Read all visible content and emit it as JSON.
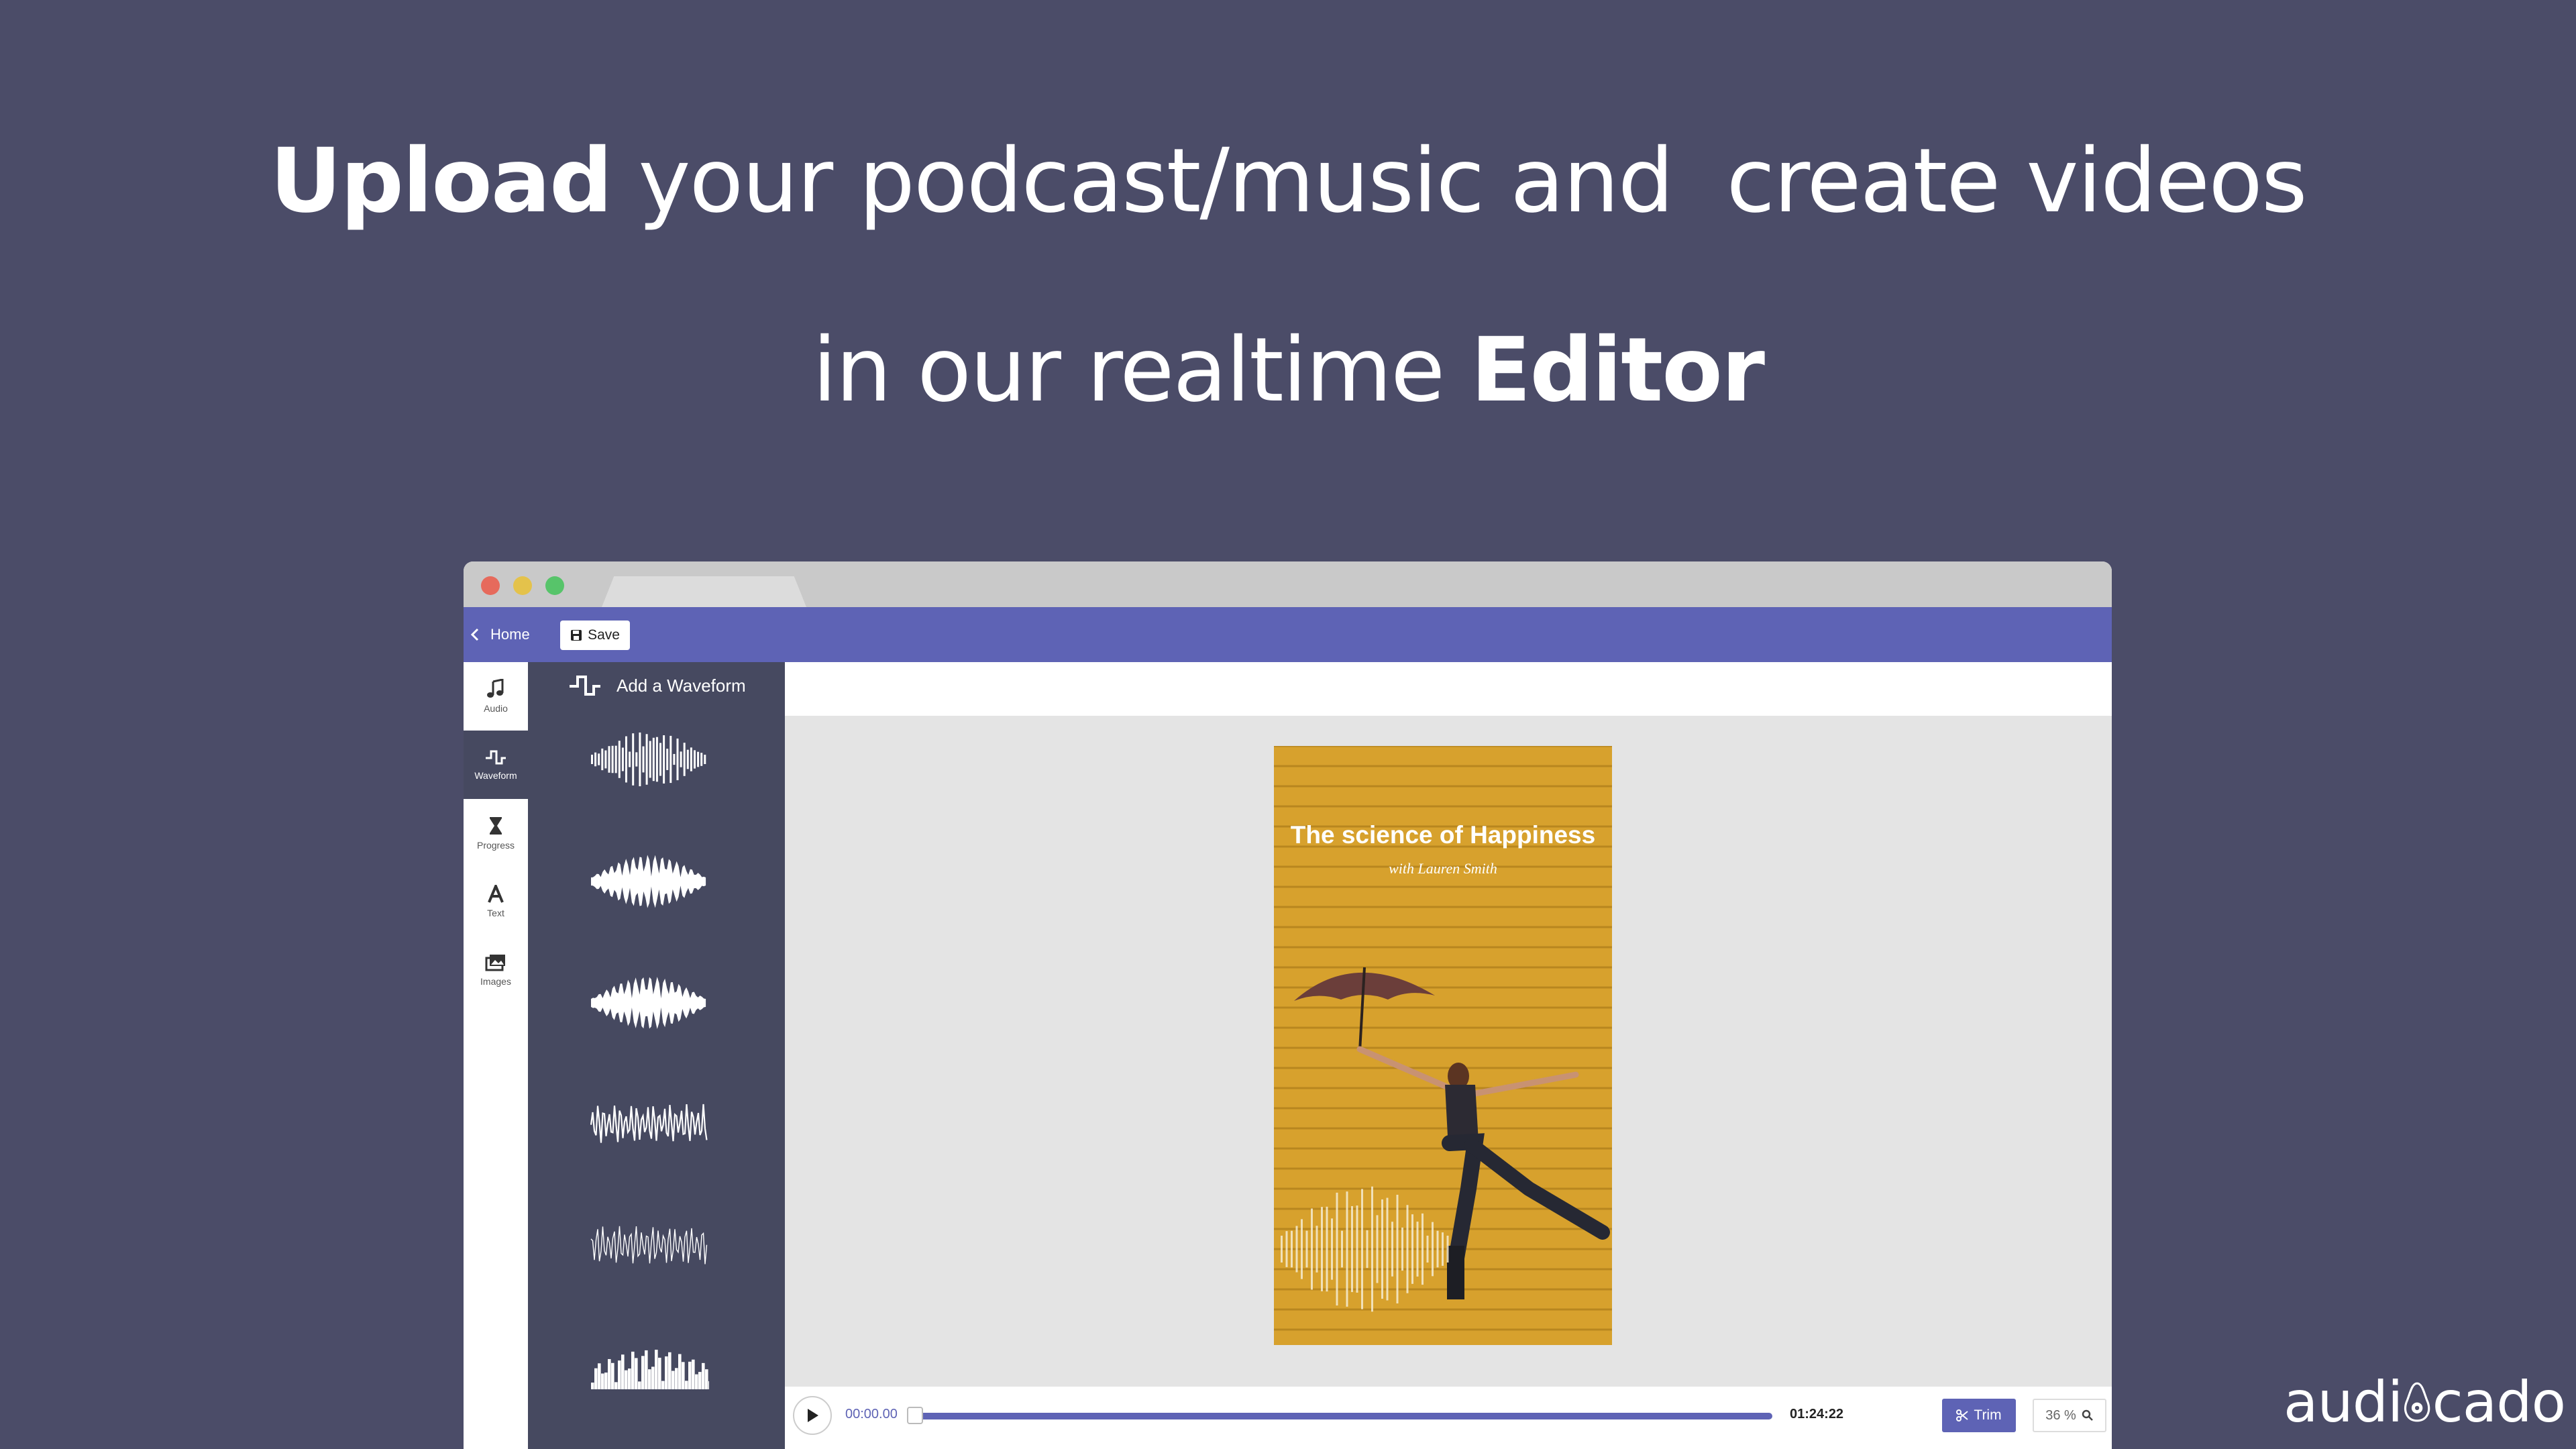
{
  "headline": {
    "line1_bold": "Upload",
    "line1_rest": " your podcast/music and  create videos",
    "line2_rest": "in our realtime ",
    "line2_bold": "Editor"
  },
  "toolbar": {
    "home_label": "Home",
    "save_label": "Save"
  },
  "rail": {
    "items": [
      {
        "label": "Audio",
        "icon": "music-note-icon"
      },
      {
        "label": "Waveform",
        "icon": "waveform-icon"
      },
      {
        "label": "Progress",
        "icon": "hourglass-icon"
      },
      {
        "label": "Text",
        "icon": "text-icon"
      },
      {
        "label": "Images",
        "icon": "images-icon"
      }
    ],
    "active": "Waveform"
  },
  "panel": {
    "title": "Add a Waveform",
    "styles": [
      "bars-mirrored",
      "spiky-mirrored",
      "spiky-dense",
      "line-wave",
      "thin-line-wave",
      "histogram"
    ]
  },
  "poster": {
    "title": "The science of Happiness",
    "subtitle": "with Lauren Smith",
    "background_color": "#d7a12d"
  },
  "player": {
    "current_time": "00:00.00",
    "total_time": "01:24:22",
    "progress": 0.0,
    "trim_label": "Trim",
    "zoom": "36 %"
  },
  "brand": {
    "logo_text_left": "audi",
    "logo_text_right": "cado",
    "accent": "#5e63b5",
    "background": "#4b4c68"
  }
}
